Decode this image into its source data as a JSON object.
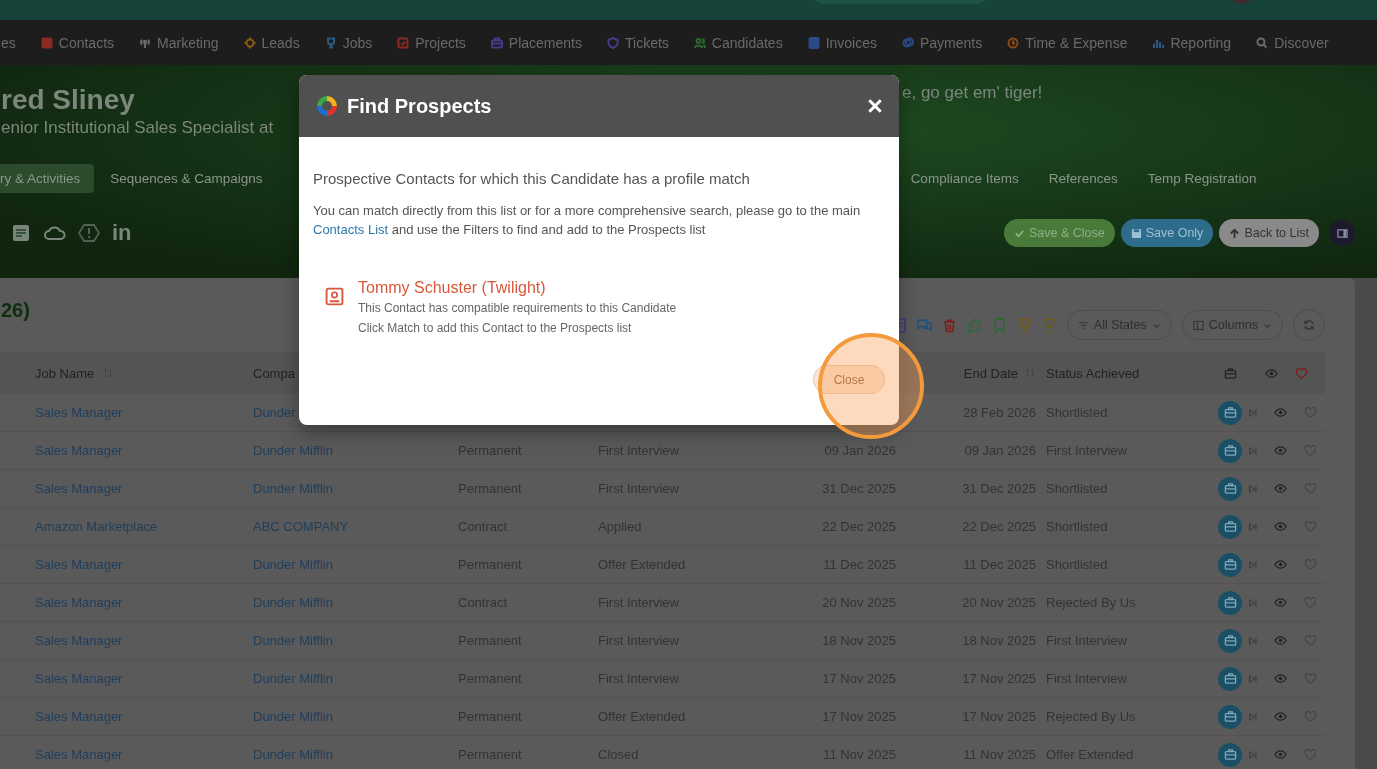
{
  "nav": [
    {
      "label": "es",
      "kind": "none"
    },
    {
      "label": "Contacts",
      "kind": "card",
      "color": "#8a2a22"
    },
    {
      "label": "Marketing",
      "kind": "antenna",
      "color": "#6b6b6b"
    },
    {
      "label": "Leads",
      "kind": "target",
      "color": "#8a5a14"
    },
    {
      "label": "Jobs",
      "kind": "trophy",
      "color": "#2a5a80"
    },
    {
      "label": "Projects",
      "kind": "checkbox",
      "color": "#8a2a22"
    },
    {
      "label": "Placements",
      "kind": "briefcase",
      "color": "#463a86"
    },
    {
      "label": "Tickets",
      "kind": "shield",
      "color": "#463a86"
    },
    {
      "label": "Candidates",
      "kind": "people",
      "color": "#2a6a2a"
    },
    {
      "label": "Invoices",
      "kind": "doc",
      "color": "#2a4a86"
    },
    {
      "label": "Payments",
      "kind": "coins",
      "color": "#2a4a86"
    },
    {
      "label": "Time & Expense",
      "kind": "clock",
      "color": "#8a4a14"
    },
    {
      "label": "Reporting",
      "kind": "bars",
      "color": "#2a5a86"
    },
    {
      "label": "Discover",
      "kind": "search",
      "color": "#6b6b6b"
    }
  ],
  "header": {
    "name": "red Sliney",
    "subtitle": "enior Institutional Sales Specialist at",
    "motto": "e, go get em' tiger!",
    "linkedin": "in",
    "tabs": [
      {
        "label": "ry & Activities",
        "selected": true
      },
      {
        "label": "Sequences & Campaigns",
        "selected": false
      },
      {
        "label": "Compliance Items",
        "selected": false
      },
      {
        "label": "References",
        "selected": false
      },
      {
        "label": "Temp Registration",
        "selected": false
      }
    ],
    "buttons": [
      {
        "label": "Save & Close",
        "kind": "save-close"
      },
      {
        "label": "Save Only",
        "kind": "save"
      },
      {
        "label": "Back to List",
        "kind": "back"
      }
    ]
  },
  "panel": {
    "title": "26)",
    "toolbar": {
      "states": "All States",
      "columns": "Columns"
    },
    "columns": {
      "job": "Job Name",
      "company": "Compa",
      "end_date": "End Date",
      "status": "Status Achieved"
    },
    "rows": [
      {
        "job": "Sales Manager",
        "company": "Dunder",
        "end_date": "28 Feb 2026",
        "status": "Shortlisted"
      },
      {
        "job": "Sales Manager",
        "company": "Dunder Mifflin",
        "type": "Permanent",
        "stage": "First Interview",
        "start_date": "09 Jan 2026",
        "end_date": "09 Jan 2026",
        "status": "First Interview"
      },
      {
        "job": "Sales Manager",
        "company": "Dunder Mifflin",
        "type": "Permanent",
        "stage": "First Interview",
        "start_date": "31 Dec 2025",
        "end_date": "31 Dec 2025",
        "status": "Shortlisted"
      },
      {
        "job": "Amazon Marketplace",
        "company": "ABC COMPANY",
        "type": "Contract",
        "stage": "Applied",
        "start_date": "22 Dec 2025",
        "end_date": "22 Dec 2025",
        "status": "Shortlisted"
      },
      {
        "job": "Sales Manager",
        "company": "Dunder Mifflin",
        "type": "Permanent",
        "stage": "Offer Extended",
        "start_date": "11 Dec 2025",
        "end_date": "11 Dec 2025",
        "status": "Shortlisted"
      },
      {
        "job": "Sales Manager",
        "company": "Dunder Mifflin",
        "type": "Contract",
        "stage": "First Interview",
        "start_date": "20 Nov 2025",
        "end_date": "20 Nov 2025",
        "status": "Rejected By Us"
      },
      {
        "job": "Sales Manager",
        "company": "Dunder Mifflin",
        "type": "Permanent",
        "stage": "First Interview",
        "start_date": "18 Nov 2025",
        "end_date": "18 Nov 2025",
        "status": "First Interview"
      },
      {
        "job": "Sales Manager",
        "company": "Dunder Mifflin",
        "type": "Permanent",
        "stage": "First Interview",
        "start_date": "17 Nov 2025",
        "end_date": "17 Nov 2025",
        "status": "First Interview"
      },
      {
        "job": "Sales Manager",
        "company": "Dunder Mifflin",
        "type": "Permanent",
        "stage": "Offer Extended",
        "start_date": "17 Nov 2025",
        "end_date": "17 Nov 2025",
        "status": "Rejected By Us"
      },
      {
        "job": "Sales Manager",
        "company": "Dunder Mifflin",
        "type": "Permanent",
        "stage": "Closed",
        "start_date": "11 Nov 2025",
        "end_date": "11 Nov 2025",
        "status": "Offer Extended"
      }
    ]
  },
  "modal": {
    "title": "Find Prospects",
    "heading": "Prospective Contacts for which this Candidate has a profile match",
    "intro_before": "You can match directly from this list or for a more comprehensive search, please go to the main",
    "intro_link": "Contacts List",
    "intro_after": "and use the Filters to find and add to the Prospects list",
    "prospects": [
      {
        "name": "Tommy Schuster (Twilight)",
        "lines": [
          "This Contact has compatible requirements to this Candidate",
          "Click Match to add this Contact to the Prospects list"
        ]
      }
    ],
    "close_button": "Close"
  }
}
